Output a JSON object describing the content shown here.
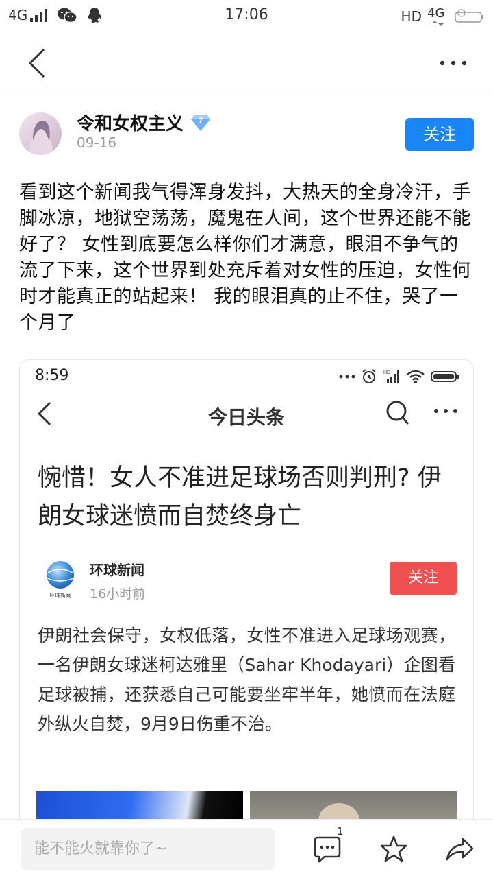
{
  "status_bar": {
    "network": "4G",
    "time": "17:06",
    "hd": "HD",
    "network_right": "4G"
  },
  "post": {
    "author": "令和女权主义",
    "verified_level": "7",
    "date": "09-16",
    "follow_label": "关注",
    "text": "看到这个新闻我气得浑身发抖，大热天的全身冷汗，手脚冰凉，地狱空荡荡，魔鬼在人间，这个世界还能不能好了？ 女性到底要怎么样你们才满意，眼泪不争气的流了下来，这个世界到处充斥着对女性的压迫，女性何时才能真正的站起来！ 我的眼泪真的止不住，哭了一个月了"
  },
  "embedded": {
    "time": "8:59",
    "nav_title": "今日头条",
    "headline": "惋惜！女人不准进足球场否则判刑? 伊朗女球迷愤而自焚终身亡",
    "source_name": "环球新闻",
    "source_logo_text": "环球新闻",
    "source_time": "16小时前",
    "follow_label": "关注",
    "summary": "伊朗社会保守，女权低落，女性不准进入足球场观赛，一名伊朗女球迷柯达雅里（Sahar Khodayari）企图看足球被捕，还获悉自己可能要坐牢半年，她愤而在法庭外纵火自焚，9月9日伤重不治。"
  },
  "bottom": {
    "comment_placeholder": "能不能火就靠你了~",
    "comment_count": "1"
  },
  "colors": {
    "follow_blue": "#1a85f6",
    "follow_red": "#f05050"
  }
}
